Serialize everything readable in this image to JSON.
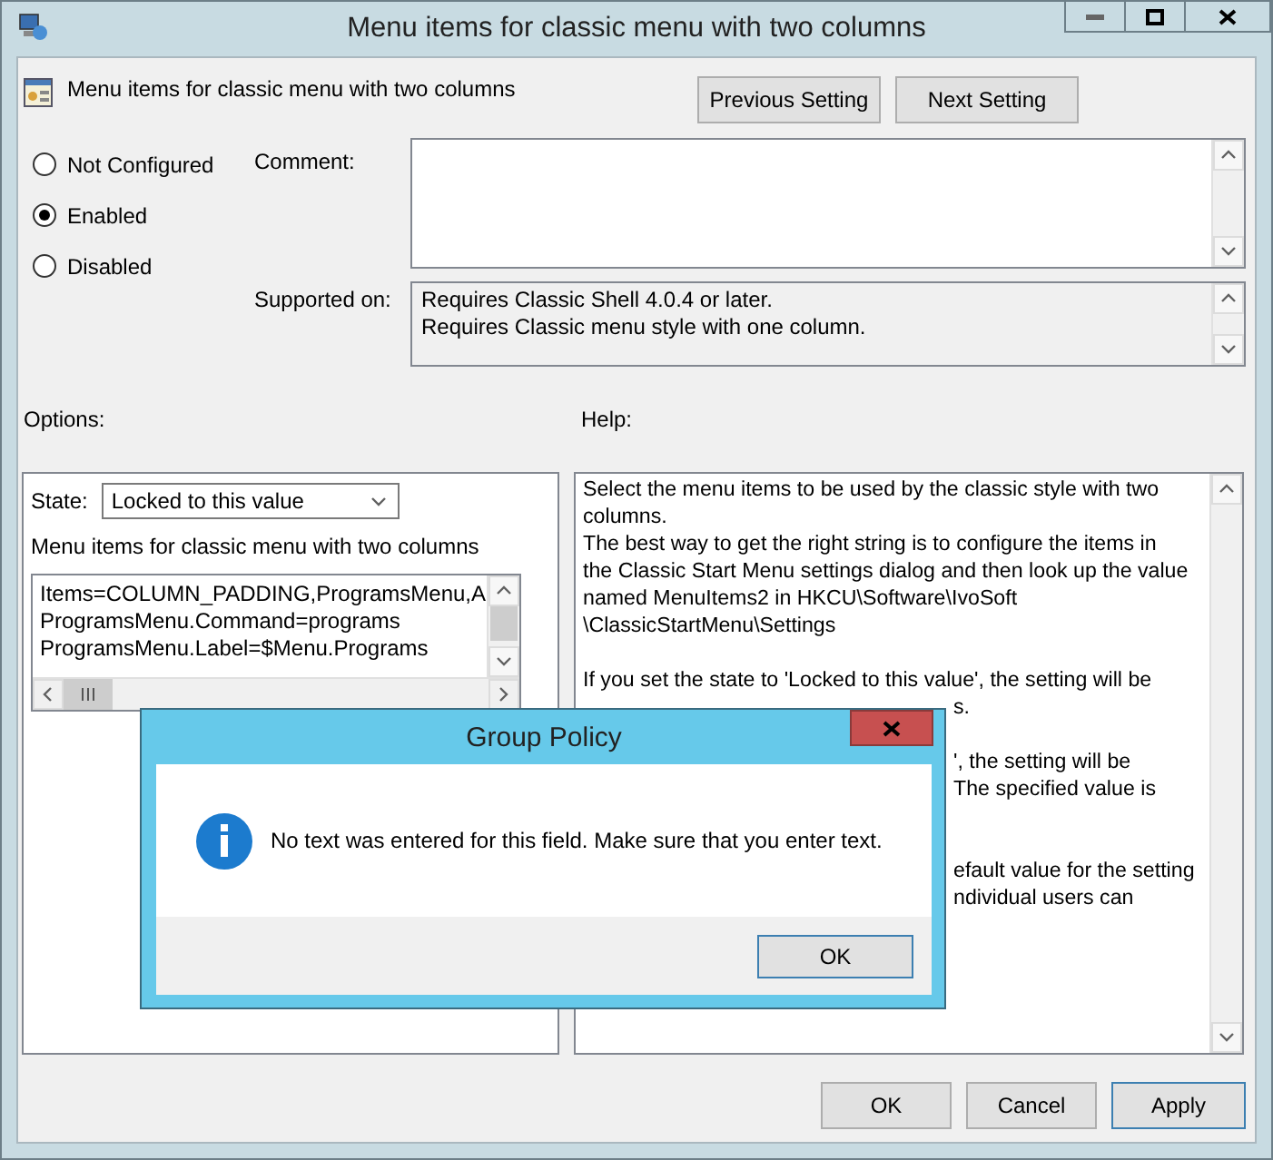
{
  "window": {
    "title": "Menu items for classic menu with two columns"
  },
  "setting_name": "Menu items for classic menu with two columns",
  "nav_buttons": [
    "Previous Setting",
    "Next Setting"
  ],
  "config_options": [
    {
      "label": "Not Configured",
      "selected": false
    },
    {
      "label": "Enabled",
      "selected": true
    },
    {
      "label": "Disabled",
      "selected": false
    }
  ],
  "comment": {
    "label": "Comment:"
  },
  "supported_on": {
    "label": "Supported on:",
    "lines": [
      "Requires Classic Shell 4.0.4 or later.",
      "Requires Classic menu style with one column."
    ]
  },
  "options": {
    "label": "Options:",
    "state_label": "State:",
    "state_value": "Locked to this value",
    "field_label": "Menu items for classic menu with two columns",
    "field_lines": [
      "Items=COLUMN_PADDING,ProgramsMenu,A",
      "ProgramsMenu.Command=programs",
      "ProgramsMenu.Label=$Menu.Programs"
    ]
  },
  "help": {
    "label": "Help:",
    "lines": [
      {
        "kind": "line",
        "text": "Select the menu items to be used by the classic style with two"
      },
      {
        "kind": "line",
        "text": "columns."
      },
      {
        "kind": "line",
        "text": "The best way to get the right string is to configure the items in"
      },
      {
        "kind": "line",
        "text": "the Classic Start Menu settings dialog and then look up the value"
      },
      {
        "kind": "line",
        "text": "named MenuItems2 in HKCU\\Software\\IvoSoft"
      },
      {
        "kind": "line",
        "text": "\\ClassicStartMenu\\Settings"
      },
      {
        "kind": "gap"
      },
      {
        "kind": "line",
        "text": "If you set the state to 'Locked to this value', the setting will be"
      },
      {
        "kind": "fragment",
        "text": "s."
      },
      {
        "kind": "gap"
      },
      {
        "kind": "fragment",
        "text": "', the setting will be"
      },
      {
        "kind": "fragment",
        "text": "The specified value is"
      },
      {
        "kind": "gap"
      },
      {
        "kind": "gap"
      },
      {
        "kind": "fragment",
        "text": "efault value for the setting"
      },
      {
        "kind": "fragment",
        "text": "ndividual users can"
      }
    ]
  },
  "footer_buttons": [
    "OK",
    "Cancel",
    "Apply"
  ],
  "dialog": {
    "title": "Group Policy",
    "message": "No text was entered for this field. Make sure that you enter text.",
    "button": "OK"
  }
}
